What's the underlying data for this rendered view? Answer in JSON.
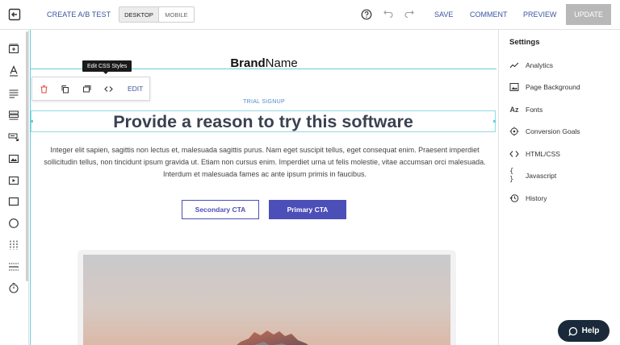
{
  "topbar": {
    "ab_test_label": "CREATE A/B TEST",
    "device_desktop": "DESKTOP",
    "device_mobile": "MOBILE",
    "save_label": "SAVE",
    "comment_label": "COMMENT",
    "preview_label": "PREVIEW",
    "update_label": "UPDATE"
  },
  "leftbar": {
    "icons": [
      "add-section-icon",
      "text-icon",
      "paragraph-icon",
      "list-icon",
      "form-icon",
      "image-icon",
      "video-icon",
      "box-icon",
      "circle-icon",
      "columns-icon",
      "divider-icon",
      "timer-icon"
    ]
  },
  "canvas": {
    "brand_part1": "Brand",
    "brand_part2": "Name",
    "tooltip": "Edit CSS Styles",
    "edit_label": "EDIT",
    "eyebrow": "TRIAL SIGNUP",
    "headline": "Provide a reason to try this software",
    "body": "Integer elit sapien, sagittis non lectus et, malesuada sagittis purus. Nam eget suscipit tellus, eget consequat enim. Praesent imperdiet sollicitudin tellus, non tincidunt ipsum gravida ut. Etiam non cursus enim. Imperdiet urna ut felis molestie, vitae accumsan orci malesuada. Interdum et malesuada fames ac ante ipsum primis in faucibus.",
    "secondary_cta": "Secondary CTA",
    "primary_cta": "Primary CTA"
  },
  "settings": {
    "title": "Settings",
    "items": [
      {
        "label": "Analytics",
        "icon": "analytics-icon"
      },
      {
        "label": "Page Background",
        "icon": "image-icon"
      },
      {
        "label": "Fonts",
        "icon": "fonts-icon"
      },
      {
        "label": "Conversion Goals",
        "icon": "target-icon"
      },
      {
        "label": "HTML/CSS",
        "icon": "code-icon"
      },
      {
        "label": "Javascript",
        "icon": "braces-icon"
      },
      {
        "label": "History",
        "icon": "history-icon"
      }
    ]
  },
  "help": {
    "label": "Help"
  },
  "colors": {
    "accent": "#4d4fb8",
    "link": "#3a55a0",
    "guide": "#5fd0dc",
    "update_disabled": "#b8b8b8"
  }
}
